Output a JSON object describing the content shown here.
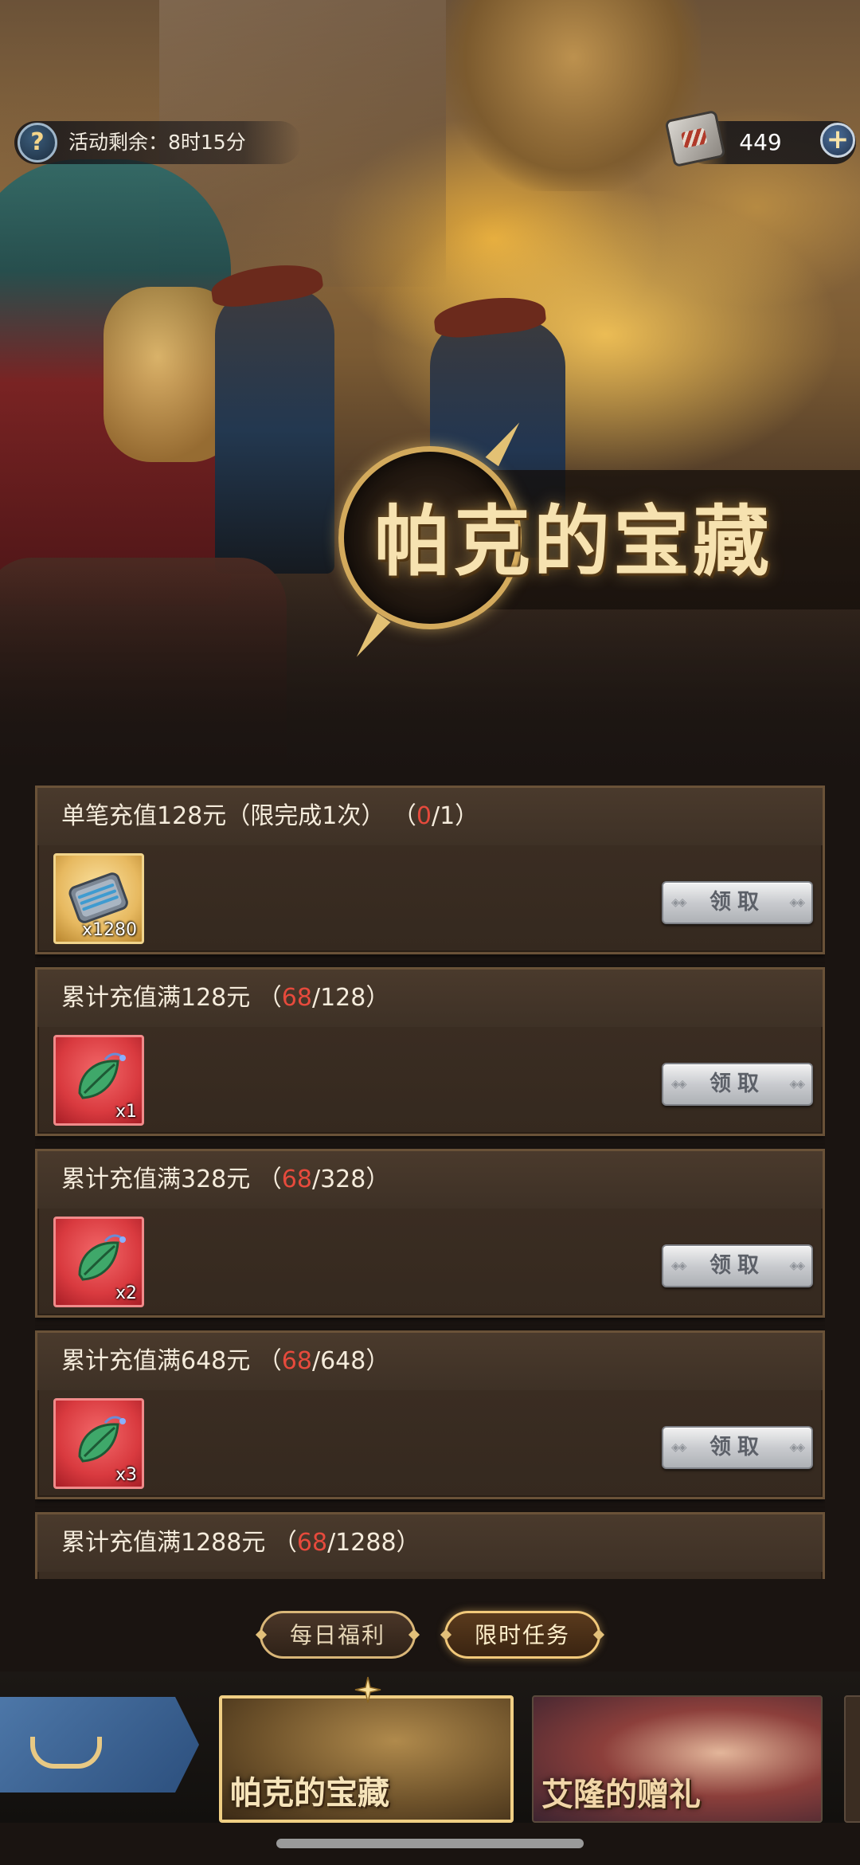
{
  "header": {
    "timer_label": "活动剩余：8时15分",
    "currency_value": "449",
    "plus_label": "+",
    "help_label": "?"
  },
  "event": {
    "title": "帕克的宝藏"
  },
  "tasks": [
    {
      "title_prefix": "单笔充值128元（限完成1次）  （",
      "progress_current": "0",
      "progress_rest": "/1）",
      "reward_icon": "scroll-icon",
      "reward_count": "x1280",
      "button_label": "领取"
    },
    {
      "title_prefix": "累计充值满128元  （",
      "progress_current": "68",
      "progress_rest": "/128）",
      "reward_icon": "leaf-icon",
      "reward_count": "x1",
      "button_label": "领取"
    },
    {
      "title_prefix": "累计充值满328元  （",
      "progress_current": "68",
      "progress_rest": "/328）",
      "reward_icon": "leaf-icon",
      "reward_count": "x2",
      "button_label": "领取"
    },
    {
      "title_prefix": "累计充值满648元  （",
      "progress_current": "68",
      "progress_rest": "/648）",
      "reward_icon": "leaf-icon",
      "reward_count": "x3",
      "button_label": "领取"
    },
    {
      "title_prefix": "累计充值满1288元  （",
      "progress_current": "68",
      "progress_rest": "/1288）"
    }
  ],
  "sub_tabs": {
    "daily": "每日福利",
    "limited": "限时任务"
  },
  "event_tabs": [
    {
      "label": "帕克的宝藏"
    },
    {
      "label": "艾隆的赠礼"
    }
  ],
  "colors": {
    "progress_current": "#e64a3c",
    "accent_gold": "#f0cf84"
  }
}
